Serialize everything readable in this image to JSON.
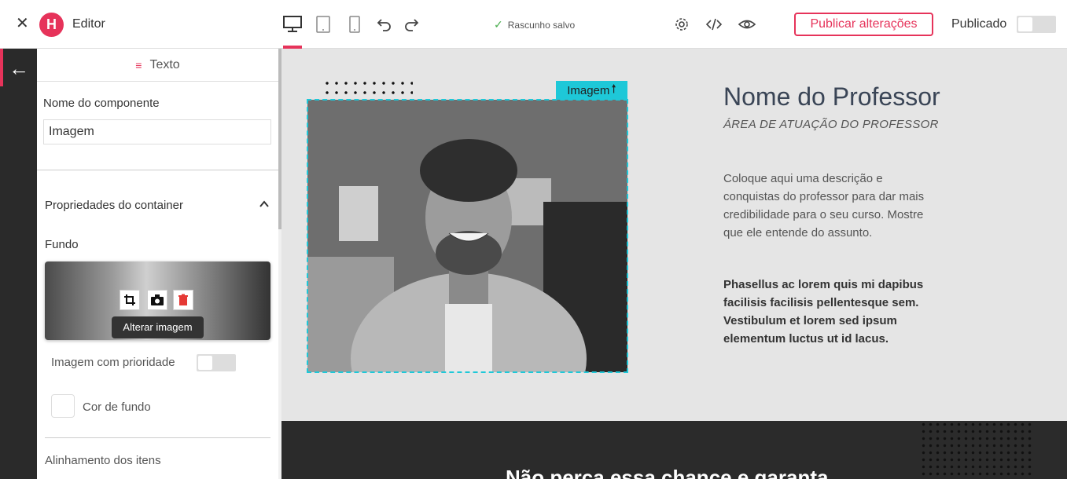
{
  "topbar": {
    "editor_label": "Editor",
    "logo_letter": "H",
    "saved_text": "Rascunho salvo",
    "publish_label": "Publicar alterações",
    "published_label": "Publicado",
    "published_on": false
  },
  "panel": {
    "tab_label": "Texto",
    "component_name_label": "Nome do componente",
    "component_name_value": "Imagem",
    "container_props_label": "Propriedades do container",
    "background_label": "Fundo",
    "tooltip": "Alterar imagem",
    "priority_label": "Imagem com prioridade",
    "priority_on": false,
    "bg_color_label": "Cor de fundo",
    "alignment_label": "Alinhamento dos itens"
  },
  "canvas": {
    "image_tag": "Imagem",
    "professor_name": "Nome do Professor",
    "professor_area": "ÁREA DE ATUAÇÃO DO PROFESSOR",
    "description": "Coloque aqui uma descrição e conquistas do professor para dar mais credibilidade para o seu curso. Mostre que ele entende do assunto.",
    "bold_text": "Phasellus ac lorem quis mi dapibus facilisis facilisis pellentesque sem. Vestibulum et lorem sed ipsum elementum luctus ut id lacus.",
    "cta_partial": "Não perca essa chance e garanta"
  },
  "colors": {
    "brand": "#e6335a",
    "selection": "#1ec8d8",
    "canvas_bg": "#e5e5e5",
    "dark_section": "#2b2b2b"
  },
  "icons": [
    "close-icon",
    "logo-icon",
    "desktop-icon",
    "tablet-icon",
    "mobile-icon",
    "undo-icon",
    "redo-icon",
    "check-icon",
    "gear-icon",
    "code-icon",
    "eye-icon",
    "back-arrow-icon",
    "text-icon",
    "chevron-up-icon",
    "crop-icon",
    "camera-icon",
    "trash-icon",
    "arrow-up-icon"
  ]
}
